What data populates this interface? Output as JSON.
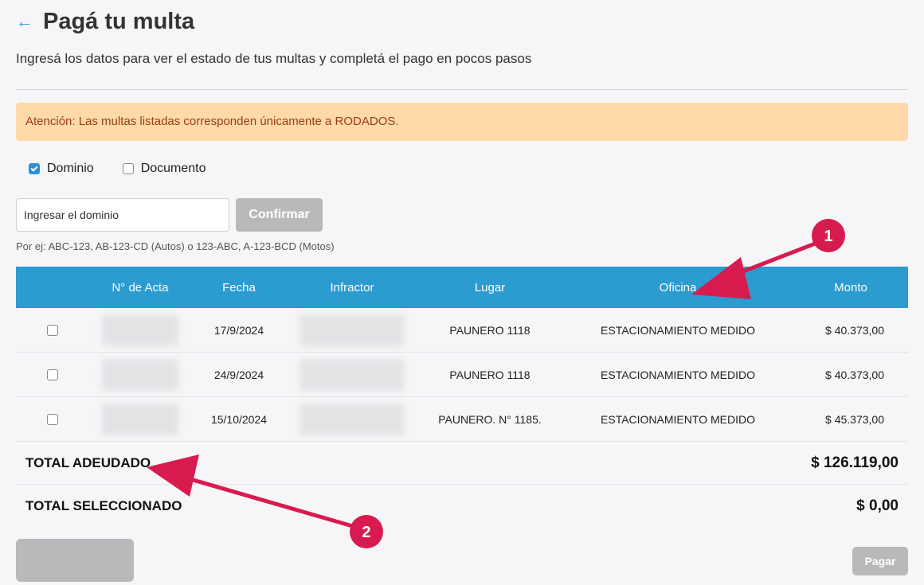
{
  "header": {
    "back_icon": "arrow-left-icon",
    "title": "Pagá tu multa"
  },
  "subtitle": "Ingresá los datos para ver el estado de tus multas y completá el pago en pocos pasos",
  "alert": "Atención: Las multas listadas corresponden únicamente a RODADOS.",
  "search_type": {
    "options": [
      {
        "label": "Dominio",
        "checked": true
      },
      {
        "label": "Documento",
        "checked": false
      }
    ]
  },
  "search": {
    "placeholder": "Ingresar el dominio",
    "confirm_label": "Confirmar",
    "hint": "Por ej: ABC-123, AB-123-CD (Autos) o 123-ABC, A-123-BCD (Motos)"
  },
  "table": {
    "headers": [
      "N° de Acta",
      "Fecha",
      "Infractor",
      "Lugar",
      "Oficina",
      "Monto"
    ],
    "rows": [
      {
        "fecha": "17/9/2024",
        "lugar": "PAUNERO 1118",
        "oficina": "ESTACIONAMIENTO MEDIDO",
        "monto": "$ 40.373,00"
      },
      {
        "fecha": "24/9/2024",
        "lugar": "PAUNERO 1118",
        "oficina": "ESTACIONAMIENTO MEDIDO",
        "monto": "$ 40.373,00"
      },
      {
        "fecha": "15/10/2024",
        "lugar": "PAUNERO. N° 1185.",
        "oficina": "ESTACIONAMIENTO MEDIDO",
        "monto": "$ 45.373,00"
      }
    ],
    "total_adeudado_label": "TOTAL ADEUDADO",
    "total_adeudado_value": "$ 126.119,00",
    "total_seleccionado_label": "TOTAL SELECCIONADO",
    "total_seleccionado_value": "$ 0,00"
  },
  "actions": {
    "pay_label": "Pagar"
  },
  "annotations": {
    "badge_1": "1",
    "badge_2": "2",
    "color": "#d81b4f"
  },
  "colors": {
    "accent": "#2b9bd0",
    "alert_bg": "#ffd9a8",
    "alert_text": "#9a3d10",
    "disabled": "#b9b9bc"
  }
}
